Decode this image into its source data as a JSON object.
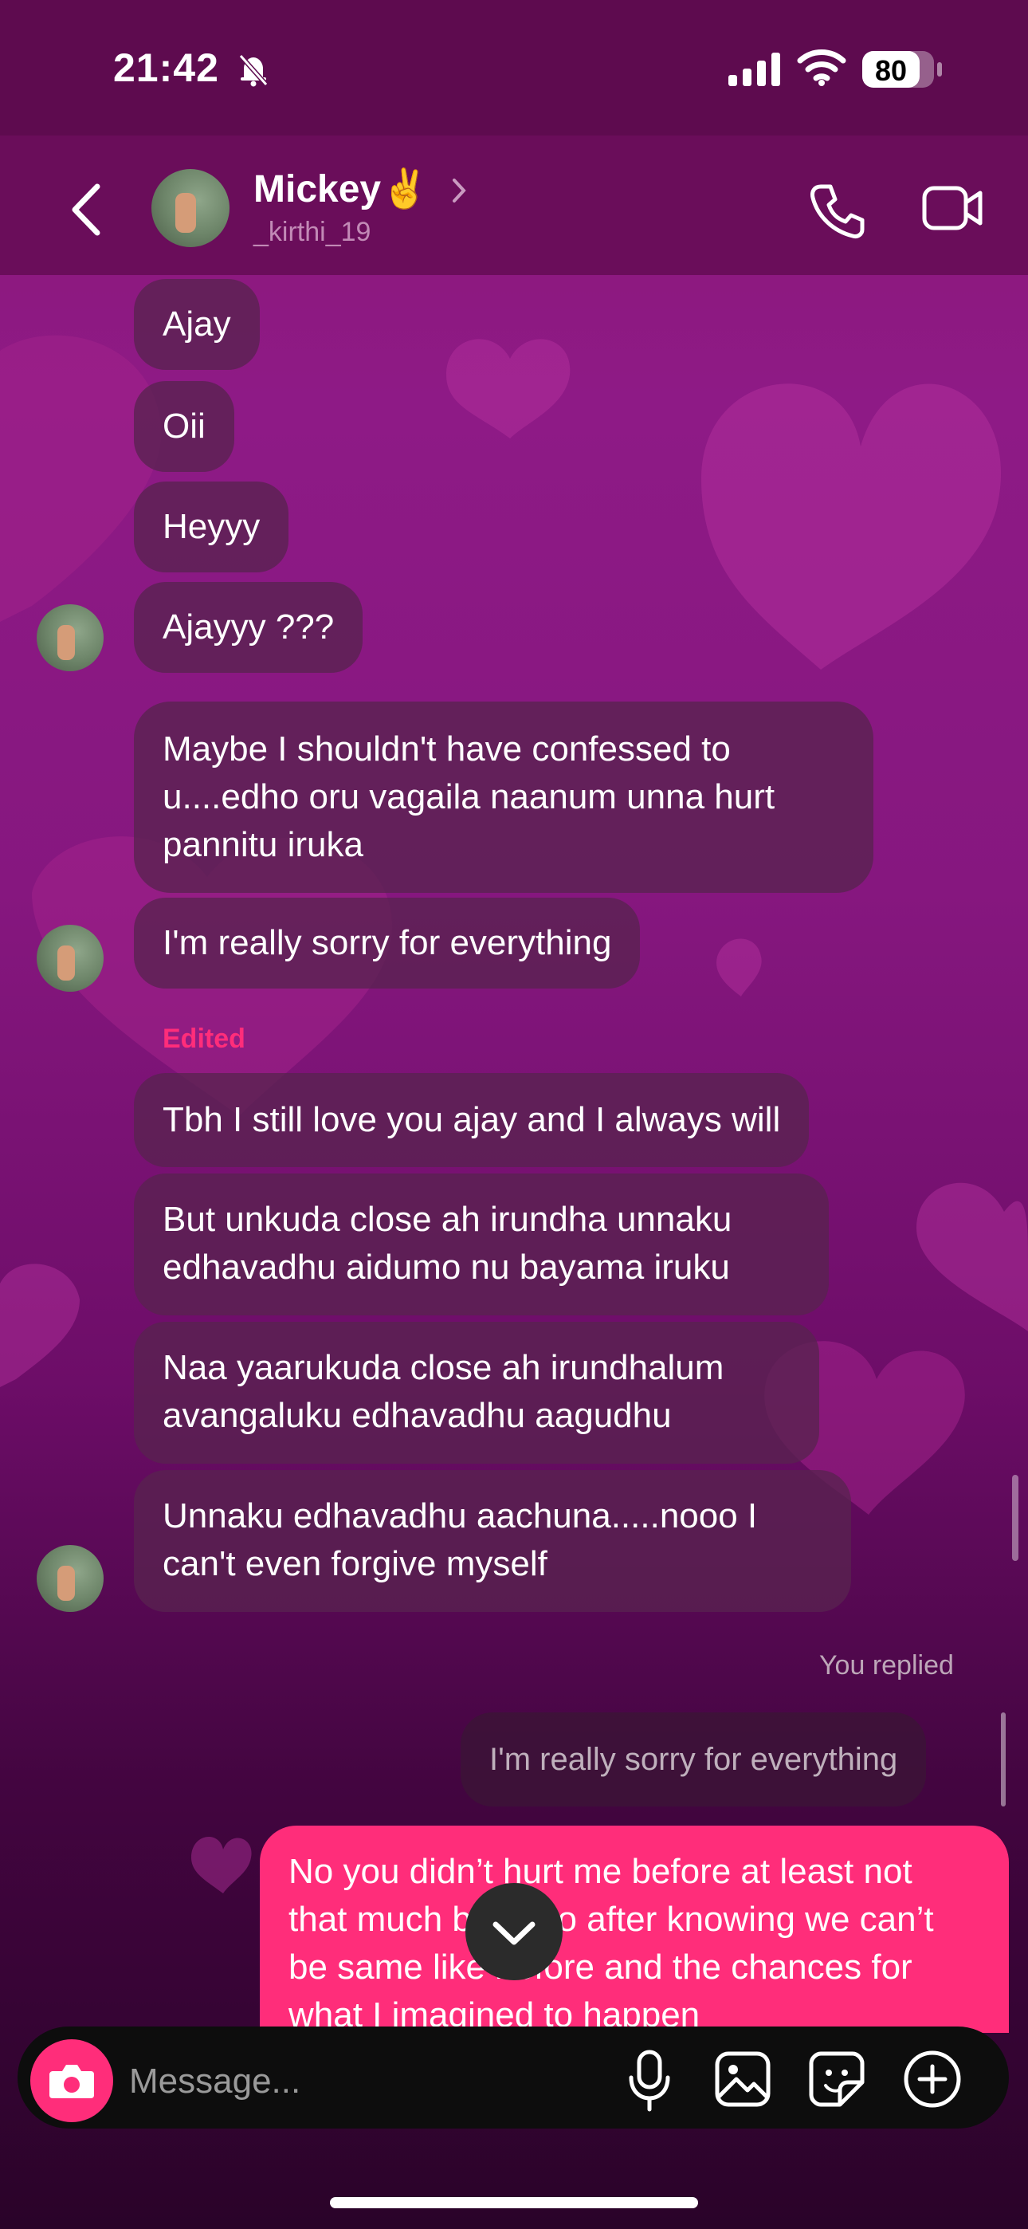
{
  "status": {
    "time": "21:42",
    "battery": "80"
  },
  "header": {
    "name": "Mickey✌️",
    "username": "_kirthi_19"
  },
  "messages": {
    "m1": "Ajay",
    "m2": "Oii",
    "m3": "Heyyy",
    "m4": "Ajayyy ???",
    "m5": "Maybe I shouldn't have confessed to u....edho oru vagaila naanum unna hurt pannitu iruka",
    "m6": "I'm really sorry for everything",
    "edited_label": "Edited",
    "m7": "Tbh I still love you ajay and I always will",
    "m8": "But unkuda close ah irundha unnaku edhavadhu aidumo nu bayama iruku",
    "m9": "Naa yaarukuda close ah irundhalum avangaluku edhavadhu aagudhu",
    "m10": "Unnaku edhavadhu aachuna.....nooo I can't even forgive myself",
    "replied_label": "You replied",
    "reply_quote": "I'm really sorry for everything",
    "my_message": "No you didn’t hurt me before at least not that much but ippo after knowing we can’t be same like before and the chances for what I imagined to happen"
  },
  "composer": {
    "placeholder": "Message..."
  },
  "colors": {
    "accent": "#ff2d7a",
    "header_bg": "#5e0b4f",
    "bubble_bg": "#582250"
  }
}
